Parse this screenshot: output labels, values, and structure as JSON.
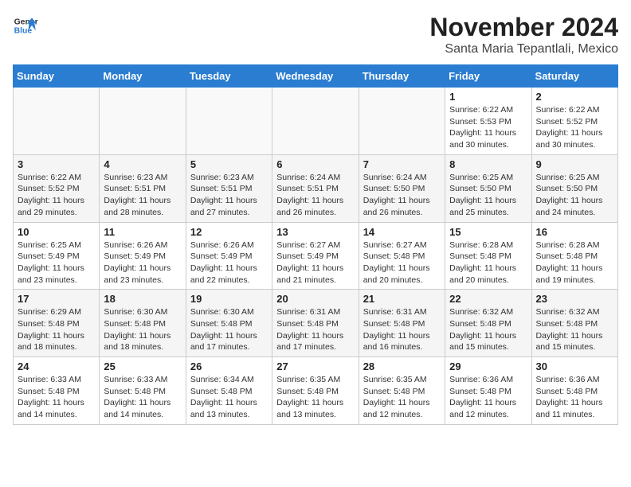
{
  "logo": {
    "line1": "General",
    "line2": "Blue"
  },
  "title": "November 2024",
  "location": "Santa Maria Tepantlali, Mexico",
  "days_of_week": [
    "Sunday",
    "Monday",
    "Tuesday",
    "Wednesday",
    "Thursday",
    "Friday",
    "Saturday"
  ],
  "weeks": [
    [
      {
        "num": "",
        "info": "",
        "empty": true
      },
      {
        "num": "",
        "info": "",
        "empty": true
      },
      {
        "num": "",
        "info": "",
        "empty": true
      },
      {
        "num": "",
        "info": "",
        "empty": true
      },
      {
        "num": "",
        "info": "",
        "empty": true
      },
      {
        "num": "1",
        "info": "Sunrise: 6:22 AM\nSunset: 5:53 PM\nDaylight: 11 hours\nand 30 minutes."
      },
      {
        "num": "2",
        "info": "Sunrise: 6:22 AM\nSunset: 5:52 PM\nDaylight: 11 hours\nand 30 minutes."
      }
    ],
    [
      {
        "num": "3",
        "info": "Sunrise: 6:22 AM\nSunset: 5:52 PM\nDaylight: 11 hours\nand 29 minutes."
      },
      {
        "num": "4",
        "info": "Sunrise: 6:23 AM\nSunset: 5:51 PM\nDaylight: 11 hours\nand 28 minutes."
      },
      {
        "num": "5",
        "info": "Sunrise: 6:23 AM\nSunset: 5:51 PM\nDaylight: 11 hours\nand 27 minutes."
      },
      {
        "num": "6",
        "info": "Sunrise: 6:24 AM\nSunset: 5:51 PM\nDaylight: 11 hours\nand 26 minutes."
      },
      {
        "num": "7",
        "info": "Sunrise: 6:24 AM\nSunset: 5:50 PM\nDaylight: 11 hours\nand 26 minutes."
      },
      {
        "num": "8",
        "info": "Sunrise: 6:25 AM\nSunset: 5:50 PM\nDaylight: 11 hours\nand 25 minutes."
      },
      {
        "num": "9",
        "info": "Sunrise: 6:25 AM\nSunset: 5:50 PM\nDaylight: 11 hours\nand 24 minutes."
      }
    ],
    [
      {
        "num": "10",
        "info": "Sunrise: 6:25 AM\nSunset: 5:49 PM\nDaylight: 11 hours\nand 23 minutes."
      },
      {
        "num": "11",
        "info": "Sunrise: 6:26 AM\nSunset: 5:49 PM\nDaylight: 11 hours\nand 23 minutes."
      },
      {
        "num": "12",
        "info": "Sunrise: 6:26 AM\nSunset: 5:49 PM\nDaylight: 11 hours\nand 22 minutes."
      },
      {
        "num": "13",
        "info": "Sunrise: 6:27 AM\nSunset: 5:49 PM\nDaylight: 11 hours\nand 21 minutes."
      },
      {
        "num": "14",
        "info": "Sunrise: 6:27 AM\nSunset: 5:48 PM\nDaylight: 11 hours\nand 20 minutes."
      },
      {
        "num": "15",
        "info": "Sunrise: 6:28 AM\nSunset: 5:48 PM\nDaylight: 11 hours\nand 20 minutes."
      },
      {
        "num": "16",
        "info": "Sunrise: 6:28 AM\nSunset: 5:48 PM\nDaylight: 11 hours\nand 19 minutes."
      }
    ],
    [
      {
        "num": "17",
        "info": "Sunrise: 6:29 AM\nSunset: 5:48 PM\nDaylight: 11 hours\nand 18 minutes."
      },
      {
        "num": "18",
        "info": "Sunrise: 6:30 AM\nSunset: 5:48 PM\nDaylight: 11 hours\nand 18 minutes."
      },
      {
        "num": "19",
        "info": "Sunrise: 6:30 AM\nSunset: 5:48 PM\nDaylight: 11 hours\nand 17 minutes."
      },
      {
        "num": "20",
        "info": "Sunrise: 6:31 AM\nSunset: 5:48 PM\nDaylight: 11 hours\nand 17 minutes."
      },
      {
        "num": "21",
        "info": "Sunrise: 6:31 AM\nSunset: 5:48 PM\nDaylight: 11 hours\nand 16 minutes."
      },
      {
        "num": "22",
        "info": "Sunrise: 6:32 AM\nSunset: 5:48 PM\nDaylight: 11 hours\nand 15 minutes."
      },
      {
        "num": "23",
        "info": "Sunrise: 6:32 AM\nSunset: 5:48 PM\nDaylight: 11 hours\nand 15 minutes."
      }
    ],
    [
      {
        "num": "24",
        "info": "Sunrise: 6:33 AM\nSunset: 5:48 PM\nDaylight: 11 hours\nand 14 minutes."
      },
      {
        "num": "25",
        "info": "Sunrise: 6:33 AM\nSunset: 5:48 PM\nDaylight: 11 hours\nand 14 minutes."
      },
      {
        "num": "26",
        "info": "Sunrise: 6:34 AM\nSunset: 5:48 PM\nDaylight: 11 hours\nand 13 minutes."
      },
      {
        "num": "27",
        "info": "Sunrise: 6:35 AM\nSunset: 5:48 PM\nDaylight: 11 hours\nand 13 minutes."
      },
      {
        "num": "28",
        "info": "Sunrise: 6:35 AM\nSunset: 5:48 PM\nDaylight: 11 hours\nand 12 minutes."
      },
      {
        "num": "29",
        "info": "Sunrise: 6:36 AM\nSunset: 5:48 PM\nDaylight: 11 hours\nand 12 minutes."
      },
      {
        "num": "30",
        "info": "Sunrise: 6:36 AM\nSunset: 5:48 PM\nDaylight: 11 hours\nand 11 minutes."
      }
    ]
  ]
}
